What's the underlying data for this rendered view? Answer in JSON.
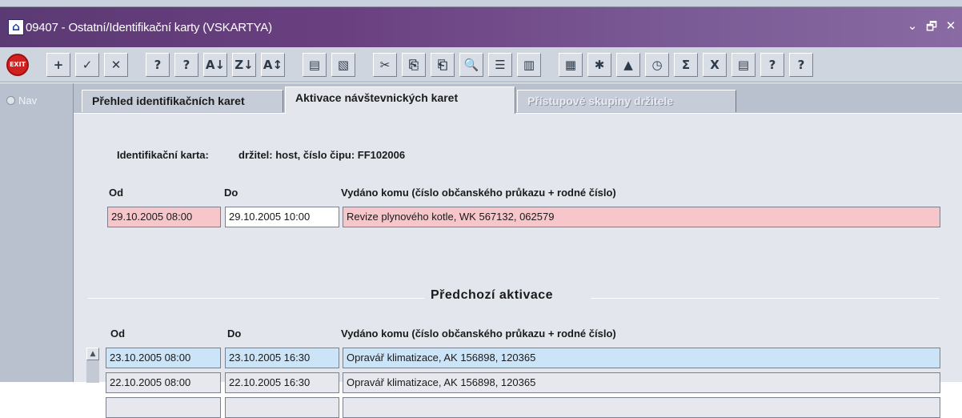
{
  "window": {
    "title": "09407 - Ostatní/Identifikační karty (VSKARTYA)",
    "controls": [
      "⌄",
      "🗗",
      "✕"
    ]
  },
  "toolbar": {
    "buttons": [
      {
        "name": "exit",
        "label": "EXIT"
      },
      {
        "name": "new-record",
        "label": "+"
      },
      {
        "name": "save",
        "label": "✓"
      },
      {
        "name": "delete",
        "label": "✕"
      },
      {
        "name": "query",
        "label": "?"
      },
      {
        "name": "query-all",
        "label": "?"
      },
      {
        "name": "sort-asc",
        "label": "A↓"
      },
      {
        "name": "sort-desc",
        "label": "Z↓"
      },
      {
        "name": "sort-multi",
        "label": "A↕"
      },
      {
        "name": "print",
        "label": "▤"
      },
      {
        "name": "print-preview",
        "label": "▧"
      },
      {
        "name": "cut",
        "label": "✂"
      },
      {
        "name": "copy",
        "label": "⎘"
      },
      {
        "name": "paste",
        "label": "⎗"
      },
      {
        "name": "find",
        "label": "🔍"
      },
      {
        "name": "list",
        "label": "☰"
      },
      {
        "name": "columns",
        "label": "▥"
      },
      {
        "name": "calculator",
        "label": "▦"
      },
      {
        "name": "settings",
        "label": "✱"
      },
      {
        "name": "triangle",
        "label": "▲"
      },
      {
        "name": "clock",
        "label": "◷"
      },
      {
        "name": "sum",
        "label": "Σ"
      },
      {
        "name": "excel",
        "label": "X"
      },
      {
        "name": "report",
        "label": "▤"
      },
      {
        "name": "help-info",
        "label": "?"
      },
      {
        "name": "help",
        "label": "?"
      }
    ]
  },
  "nav": {
    "label": "Nav"
  },
  "tabs": [
    {
      "label": "Přehled identifikačních karet"
    },
    {
      "label": "Aktivace návštevnických karet"
    },
    {
      "label": "Přístupové skupiny držitele"
    }
  ],
  "card": {
    "label": "Identifikační karta:",
    "value": "držitel: host,  číslo čipu: FF102006"
  },
  "current": {
    "headers": {
      "od": "Od",
      "do": "Do",
      "komu": "Vydáno komu (číslo občanského průkazu + rodné číslo)"
    },
    "row": {
      "od": "29.10.2005 08:00",
      "do": "29.10.2005 10:00",
      "komu": "Revize plynového kotle, WK 567132, 062579"
    }
  },
  "previous": {
    "title": "Předchozí aktivace",
    "headers": {
      "od": "Od",
      "do": "Do",
      "komu": "Vydáno komu (číslo občanského průkazu + rodné číslo)"
    },
    "rows": [
      {
        "od": "23.10.2005 08:00",
        "do": "23.10.2005 16:30",
        "komu": "Opravář klimatizace, AK 156898, 120365"
      },
      {
        "od": "22.10.2005 08:00",
        "do": "22.10.2005 16:30",
        "komu": "Opravář klimatizace, AK 156898, 120365"
      },
      {
        "od": "",
        "do": "",
        "komu": ""
      }
    ]
  },
  "colors": {
    "title_bar": "#5b3a73",
    "current_row": "#f7c6cb",
    "selected_row": "#cce4f7",
    "panel": "#e3e6ec"
  }
}
